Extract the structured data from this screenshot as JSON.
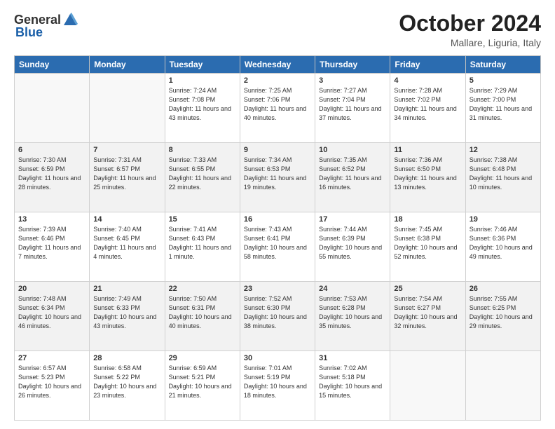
{
  "header": {
    "logo_general": "General",
    "logo_blue": "Blue",
    "month": "October 2024",
    "location": "Mallare, Liguria, Italy"
  },
  "days_of_week": [
    "Sunday",
    "Monday",
    "Tuesday",
    "Wednesday",
    "Thursday",
    "Friday",
    "Saturday"
  ],
  "weeks": [
    [
      {
        "day": "",
        "sunrise": "",
        "sunset": "",
        "daylight": ""
      },
      {
        "day": "",
        "sunrise": "",
        "sunset": "",
        "daylight": ""
      },
      {
        "day": "1",
        "sunrise": "Sunrise: 7:24 AM",
        "sunset": "Sunset: 7:08 PM",
        "daylight": "Daylight: 11 hours and 43 minutes."
      },
      {
        "day": "2",
        "sunrise": "Sunrise: 7:25 AM",
        "sunset": "Sunset: 7:06 PM",
        "daylight": "Daylight: 11 hours and 40 minutes."
      },
      {
        "day": "3",
        "sunrise": "Sunrise: 7:27 AM",
        "sunset": "Sunset: 7:04 PM",
        "daylight": "Daylight: 11 hours and 37 minutes."
      },
      {
        "day": "4",
        "sunrise": "Sunrise: 7:28 AM",
        "sunset": "Sunset: 7:02 PM",
        "daylight": "Daylight: 11 hours and 34 minutes."
      },
      {
        "day": "5",
        "sunrise": "Sunrise: 7:29 AM",
        "sunset": "Sunset: 7:00 PM",
        "daylight": "Daylight: 11 hours and 31 minutes."
      }
    ],
    [
      {
        "day": "6",
        "sunrise": "Sunrise: 7:30 AM",
        "sunset": "Sunset: 6:59 PM",
        "daylight": "Daylight: 11 hours and 28 minutes."
      },
      {
        "day": "7",
        "sunrise": "Sunrise: 7:31 AM",
        "sunset": "Sunset: 6:57 PM",
        "daylight": "Daylight: 11 hours and 25 minutes."
      },
      {
        "day": "8",
        "sunrise": "Sunrise: 7:33 AM",
        "sunset": "Sunset: 6:55 PM",
        "daylight": "Daylight: 11 hours and 22 minutes."
      },
      {
        "day": "9",
        "sunrise": "Sunrise: 7:34 AM",
        "sunset": "Sunset: 6:53 PM",
        "daylight": "Daylight: 11 hours and 19 minutes."
      },
      {
        "day": "10",
        "sunrise": "Sunrise: 7:35 AM",
        "sunset": "Sunset: 6:52 PM",
        "daylight": "Daylight: 11 hours and 16 minutes."
      },
      {
        "day": "11",
        "sunrise": "Sunrise: 7:36 AM",
        "sunset": "Sunset: 6:50 PM",
        "daylight": "Daylight: 11 hours and 13 minutes."
      },
      {
        "day": "12",
        "sunrise": "Sunrise: 7:38 AM",
        "sunset": "Sunset: 6:48 PM",
        "daylight": "Daylight: 11 hours and 10 minutes."
      }
    ],
    [
      {
        "day": "13",
        "sunrise": "Sunrise: 7:39 AM",
        "sunset": "Sunset: 6:46 PM",
        "daylight": "Daylight: 11 hours and 7 minutes."
      },
      {
        "day": "14",
        "sunrise": "Sunrise: 7:40 AM",
        "sunset": "Sunset: 6:45 PM",
        "daylight": "Daylight: 11 hours and 4 minutes."
      },
      {
        "day": "15",
        "sunrise": "Sunrise: 7:41 AM",
        "sunset": "Sunset: 6:43 PM",
        "daylight": "Daylight: 11 hours and 1 minute."
      },
      {
        "day": "16",
        "sunrise": "Sunrise: 7:43 AM",
        "sunset": "Sunset: 6:41 PM",
        "daylight": "Daylight: 10 hours and 58 minutes."
      },
      {
        "day": "17",
        "sunrise": "Sunrise: 7:44 AM",
        "sunset": "Sunset: 6:39 PM",
        "daylight": "Daylight: 10 hours and 55 minutes."
      },
      {
        "day": "18",
        "sunrise": "Sunrise: 7:45 AM",
        "sunset": "Sunset: 6:38 PM",
        "daylight": "Daylight: 10 hours and 52 minutes."
      },
      {
        "day": "19",
        "sunrise": "Sunrise: 7:46 AM",
        "sunset": "Sunset: 6:36 PM",
        "daylight": "Daylight: 10 hours and 49 minutes."
      }
    ],
    [
      {
        "day": "20",
        "sunrise": "Sunrise: 7:48 AM",
        "sunset": "Sunset: 6:34 PM",
        "daylight": "Daylight: 10 hours and 46 minutes."
      },
      {
        "day": "21",
        "sunrise": "Sunrise: 7:49 AM",
        "sunset": "Sunset: 6:33 PM",
        "daylight": "Daylight: 10 hours and 43 minutes."
      },
      {
        "day": "22",
        "sunrise": "Sunrise: 7:50 AM",
        "sunset": "Sunset: 6:31 PM",
        "daylight": "Daylight: 10 hours and 40 minutes."
      },
      {
        "day": "23",
        "sunrise": "Sunrise: 7:52 AM",
        "sunset": "Sunset: 6:30 PM",
        "daylight": "Daylight: 10 hours and 38 minutes."
      },
      {
        "day": "24",
        "sunrise": "Sunrise: 7:53 AM",
        "sunset": "Sunset: 6:28 PM",
        "daylight": "Daylight: 10 hours and 35 minutes."
      },
      {
        "day": "25",
        "sunrise": "Sunrise: 7:54 AM",
        "sunset": "Sunset: 6:27 PM",
        "daylight": "Daylight: 10 hours and 32 minutes."
      },
      {
        "day": "26",
        "sunrise": "Sunrise: 7:55 AM",
        "sunset": "Sunset: 6:25 PM",
        "daylight": "Daylight: 10 hours and 29 minutes."
      }
    ],
    [
      {
        "day": "27",
        "sunrise": "Sunrise: 6:57 AM",
        "sunset": "Sunset: 5:23 PM",
        "daylight": "Daylight: 10 hours and 26 minutes."
      },
      {
        "day": "28",
        "sunrise": "Sunrise: 6:58 AM",
        "sunset": "Sunset: 5:22 PM",
        "daylight": "Daylight: 10 hours and 23 minutes."
      },
      {
        "day": "29",
        "sunrise": "Sunrise: 6:59 AM",
        "sunset": "Sunset: 5:21 PM",
        "daylight": "Daylight: 10 hours and 21 minutes."
      },
      {
        "day": "30",
        "sunrise": "Sunrise: 7:01 AM",
        "sunset": "Sunset: 5:19 PM",
        "daylight": "Daylight: 10 hours and 18 minutes."
      },
      {
        "day": "31",
        "sunrise": "Sunrise: 7:02 AM",
        "sunset": "Sunset: 5:18 PM",
        "daylight": "Daylight: 10 hours and 15 minutes."
      },
      {
        "day": "",
        "sunrise": "",
        "sunset": "",
        "daylight": ""
      },
      {
        "day": "",
        "sunrise": "",
        "sunset": "",
        "daylight": ""
      }
    ]
  ]
}
